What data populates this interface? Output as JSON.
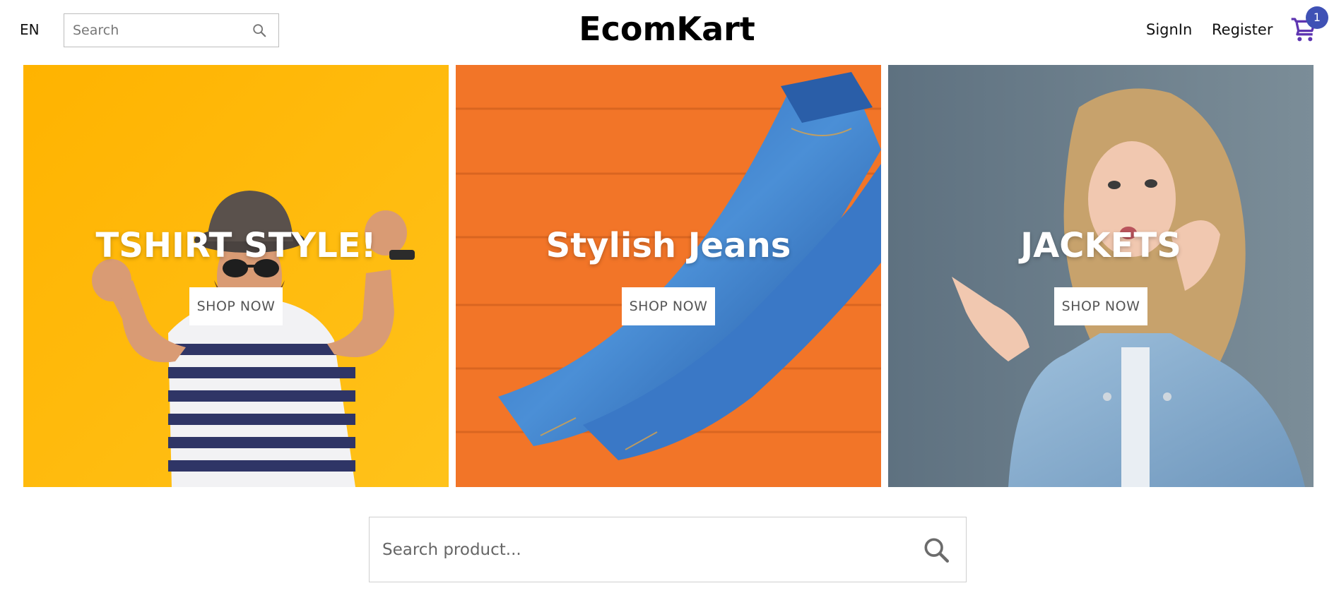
{
  "header": {
    "language": "EN",
    "search_placeholder": "Search",
    "logo": "EcomKart",
    "signin_label": "SignIn",
    "register_label": "Register",
    "cart_count": "1"
  },
  "slides": [
    {
      "title": "TSHIRT STYLE!",
      "button": "SHOP NOW",
      "background": "#ffb703"
    },
    {
      "title": "Stylish Jeans",
      "button": "SHOP NOW",
      "background": "#f27528"
    },
    {
      "title": "JACKETS",
      "button": "SHOP NOW",
      "background": "#6a7e8b"
    }
  ],
  "product_search": {
    "placeholder": "Search product..."
  },
  "colors": {
    "accent": "#3f51b5",
    "cart_icon": "#5e35b1"
  },
  "icons": {
    "search": "search-icon",
    "cart": "cart-icon"
  }
}
